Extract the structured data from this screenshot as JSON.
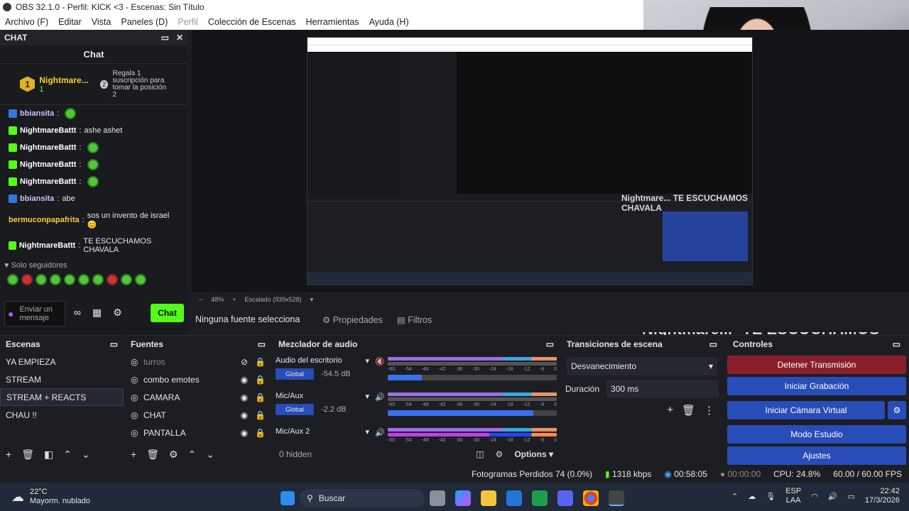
{
  "window": {
    "title": "OBS 32.1.0 - Perfil: KICK <3 - Escenas: Sin Título"
  },
  "menu": [
    "Archivo (F)",
    "Editar",
    "Vista",
    "Paneles (D)",
    "Perfil",
    "Colección de Escenas",
    "Herramientas",
    "Ayuda (H)"
  ],
  "chat": {
    "dock_title": "CHAT",
    "title": "Chat",
    "pinned": {
      "user": "Nightmare...",
      "count": "1",
      "rank": "1",
      "note": "Regala 1 suscripción para tomar la posición 2",
      "rank_next": "2"
    },
    "messages": [
      {
        "user": "bbiansita",
        "text": "",
        "emote": true
      },
      {
        "user": "NightmareBattt",
        "text": "ashe ashet",
        "emote": false
      },
      {
        "user": "NightmareBattt",
        "text": "",
        "emote": true
      },
      {
        "user": "NightmareBattt",
        "text": "",
        "emote": true
      },
      {
        "user": "NightmareBattt",
        "text": "",
        "emote": true
      },
      {
        "user": "bbiansita",
        "text": "abe",
        "emote": false
      },
      {
        "user": "bermuconpapafrita",
        "text": "sos un invento de israel 😊",
        "emote": false
      },
      {
        "user": "NightmareBattt",
        "text": "TE ESCUCHAMOS CHAVALA",
        "emote": false
      }
    ],
    "followers_only": "Solo seguidores",
    "input_placeholder": "Enviar un mensaje",
    "send_label": "Chat"
  },
  "preview": {
    "zoom": "48%",
    "scaling": "Escalado (939x528)",
    "overlay_name": "Nightmare...",
    "overlay_msg": "TE ESCUCHAMOS CHAVALA"
  },
  "props_bar": {
    "no_source": "Ninguna fuente selecciona",
    "properties": "Propiedades",
    "filters": "Filtros"
  },
  "scenes": {
    "title": "Escenas",
    "items": [
      "YA EMPIEZA",
      "STREAM",
      "STREAM + REACTS",
      "CHAU !!"
    ],
    "selected": "STREAM + REACTS"
  },
  "sources": {
    "title": "Fuentes",
    "items": [
      "turros",
      "combo emotes",
      "CAMARA",
      "CHAT",
      "PANTALLA"
    ]
  },
  "mixer": {
    "title": "Mezclador de audio",
    "channels": [
      {
        "name": "Audio del escritorio",
        "tag": "Global",
        "db": "-54.5 dB",
        "level": 0.2
      },
      {
        "name": "Mic/Aux",
        "tag": "Global",
        "db": "-2.2 dB",
        "level": 0.86
      },
      {
        "name": "Mic/Aux 2",
        "tag": "",
        "db": "",
        "level": 0.0
      }
    ],
    "ticks": [
      "-60",
      "-54",
      "-48",
      "-42",
      "-36",
      "-30",
      "-24",
      "-18",
      "-12",
      "-6",
      "0"
    ],
    "hidden": "0 hidden",
    "options": "Options"
  },
  "transitions": {
    "title": "Transiciones de escena",
    "type": "Desvanecimiento",
    "duration_label": "Duración",
    "duration": "300 ms"
  },
  "controls": {
    "title": "Controles",
    "buttons": [
      "Detener Transmisión",
      "Iniciar Grabación",
      "Iniciar Cámara Virtual",
      "Modo Estudio",
      "Ajustes"
    ]
  },
  "status": {
    "dropped": "Fotogramas Perdidos 74 (0.0%)",
    "kbps": "1318 kbps",
    "stream_time": "00:58:05",
    "rec_time": "00:00:00",
    "cpu": "CPU: 24.8%",
    "fps": "60.00 / 60.00 FPS"
  },
  "taskbar": {
    "temp": "22°C",
    "weather": "Mayorm. nublado",
    "search": "Buscar",
    "lang": "ESP",
    "region": "LAA",
    "time": "22:42",
    "date": "17/3/2026"
  },
  "colors": {
    "accent": "#53fc18",
    "control": "#284cb8",
    "stop": "#8a1f2c",
    "bg": "#1d1e24"
  }
}
